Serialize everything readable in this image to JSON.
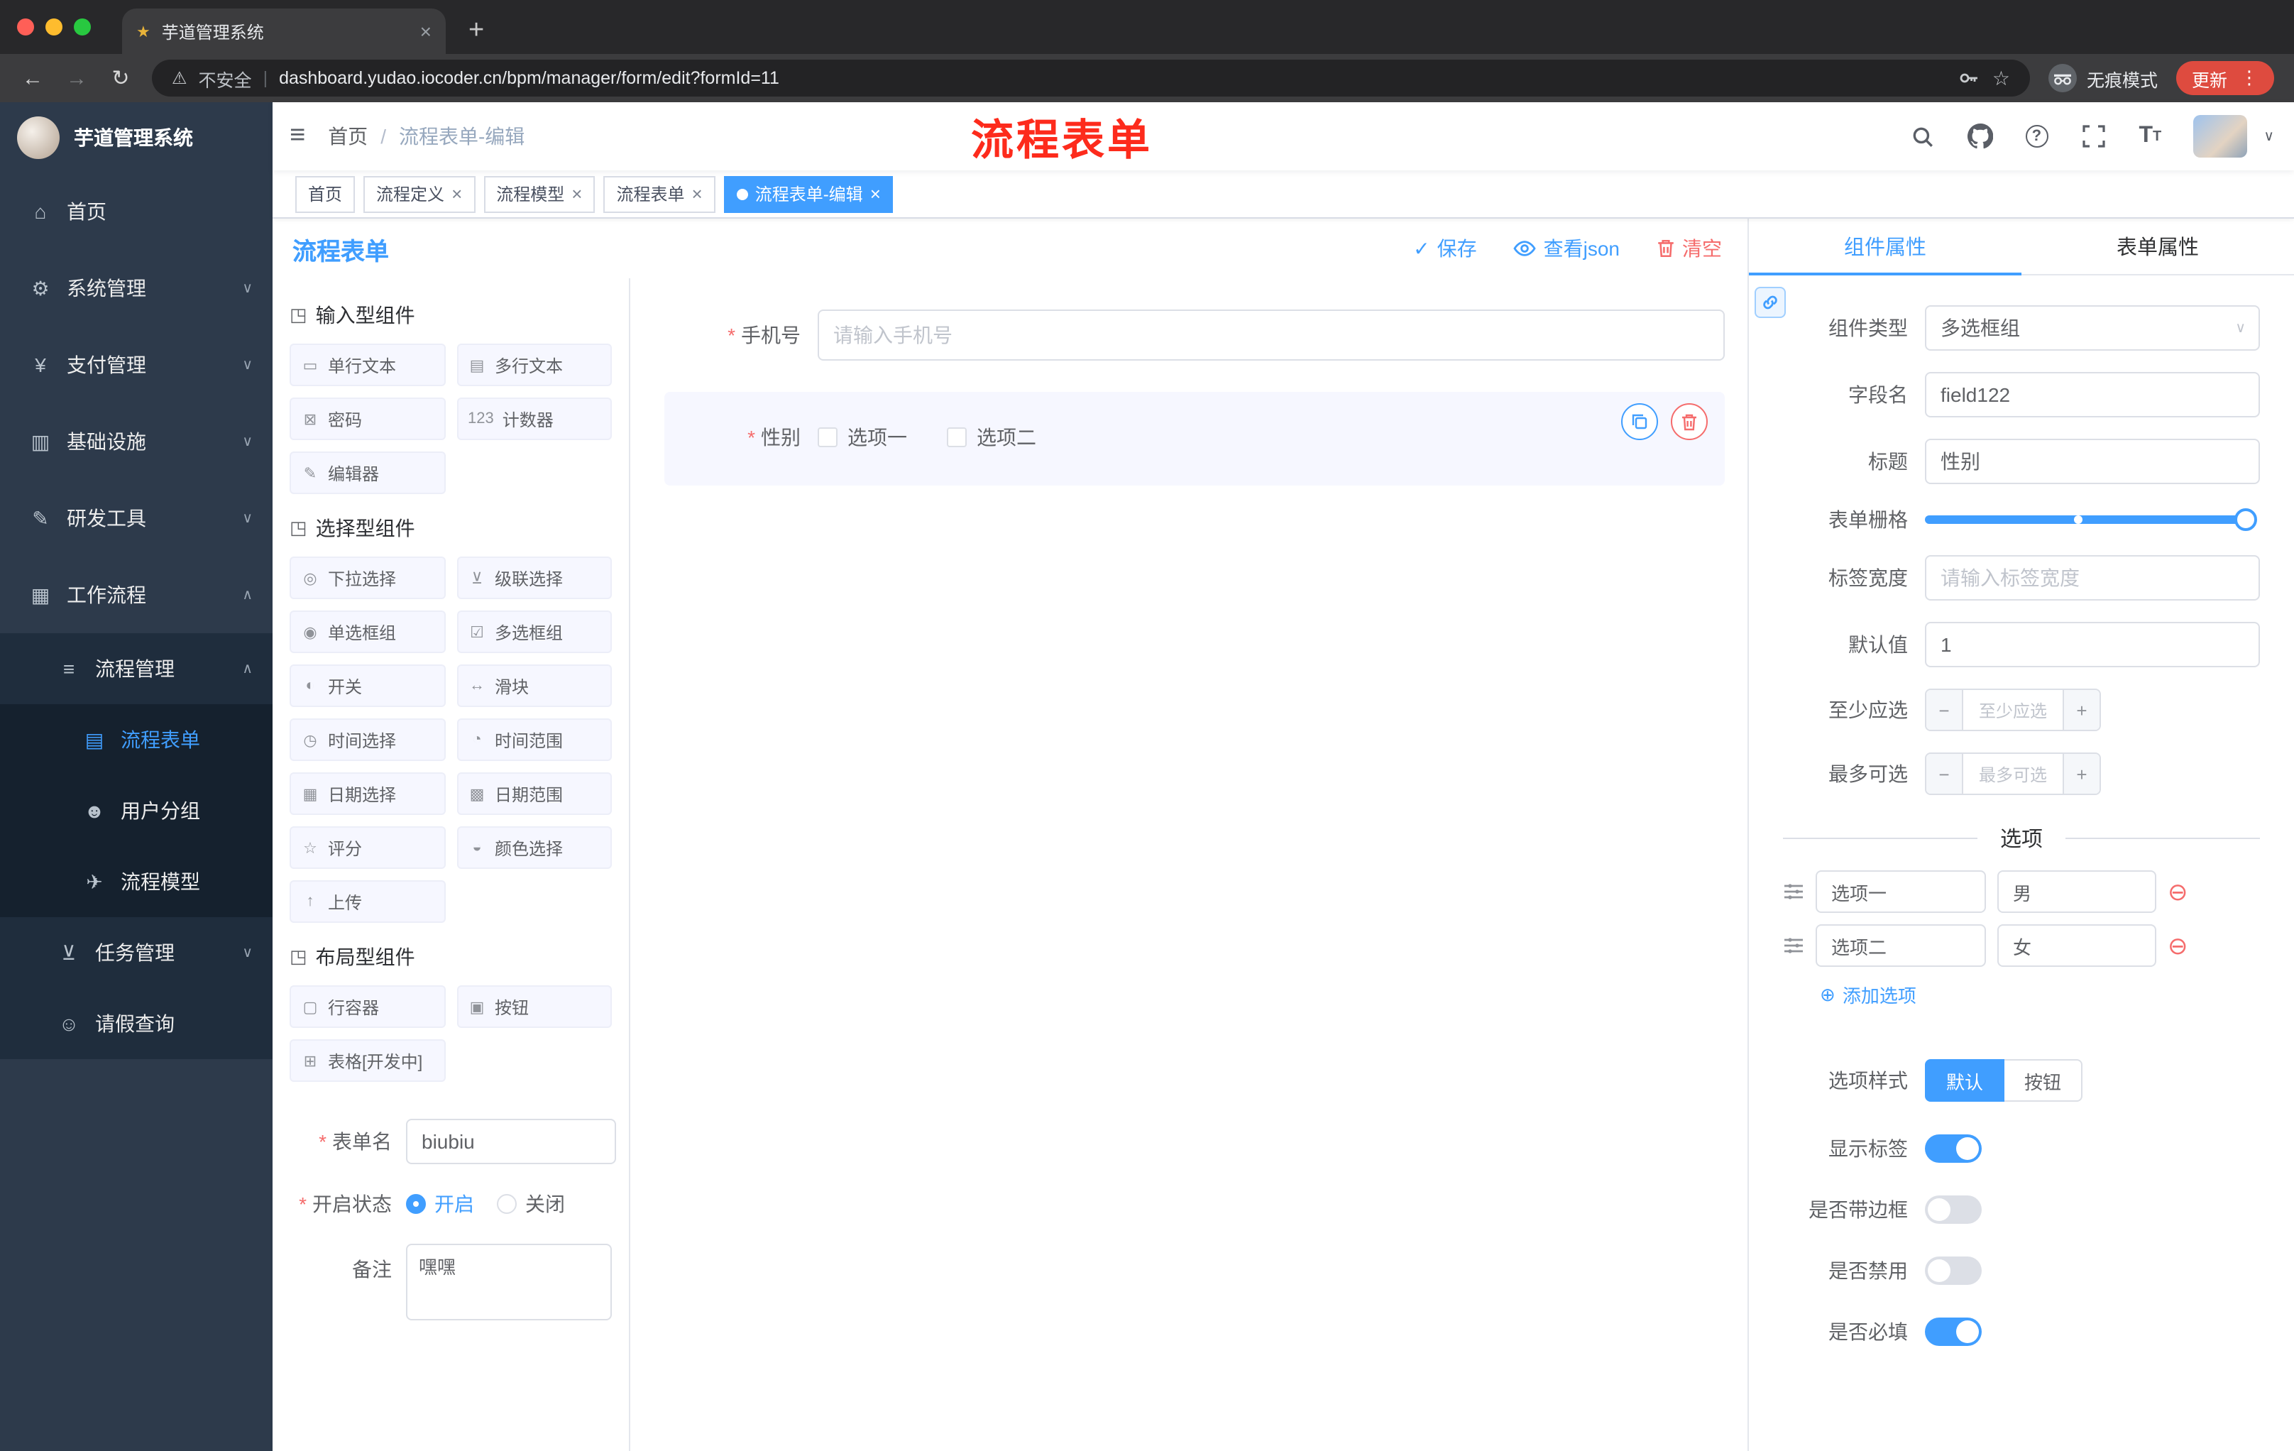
{
  "colors": {
    "primary": "#409eff",
    "danger": "#f56c6c",
    "annotation_red": "#fd2b1c",
    "sidebar_bg": "#2d3a4b"
  },
  "icons": {
    "hamburger": "≡",
    "back": "←",
    "forward": "→",
    "reload": "↻",
    "warning": "⚠",
    "pipe": "|",
    "star": "☆",
    "menu_dots": "⋮",
    "close": "×",
    "new_tab": "+",
    "favicon": "★",
    "caret_down": "∨",
    "check": "✓",
    "question": "?",
    "font_size": "T",
    "plus_circle": "⊕",
    "minus_circle": "⊖",
    "minus": "−",
    "plus": "+"
  },
  "browser": {
    "tab": {
      "title": "芋道管理系统"
    },
    "toolbar": {
      "security_label": "不安全",
      "url": "dashboard.yudao.iocoder.cn/bpm/manager/form/edit?formId=11",
      "incognito_label": "无痕模式",
      "update_label": "更新"
    }
  },
  "sidebar": {
    "brand": "芋道管理系统",
    "menu": [
      {
        "icon": "⌂",
        "label": "首页",
        "level": 1,
        "chevron": ""
      },
      {
        "icon": "⚙",
        "label": "系统管理",
        "level": 1,
        "chevron": "∨"
      },
      {
        "icon": "¥",
        "label": "支付管理",
        "level": 1,
        "chevron": "∨"
      },
      {
        "icon": "▥",
        "label": "基础设施",
        "level": 1,
        "chevron": "∨"
      },
      {
        "icon": "✎",
        "label": "研发工具",
        "level": 1,
        "chevron": "∨"
      },
      {
        "icon": "▦",
        "label": "工作流程",
        "level": 1,
        "chevron": "∧",
        "expanded": true
      },
      {
        "icon": "≡",
        "label": "流程管理",
        "level": 2,
        "chevron": "∧",
        "expanded": true
      },
      {
        "icon": "▤",
        "label": "流程表单",
        "level": 3,
        "chevron": "",
        "active": true
      },
      {
        "icon": "☻",
        "label": "用户分组",
        "level": 3,
        "chevron": ""
      },
      {
        "icon": "✈",
        "label": "流程模型",
        "level": 3,
        "chevron": ""
      },
      {
        "icon": "⊻",
        "label": "任务管理",
        "level": 2,
        "chevron": "∨"
      },
      {
        "icon": "☺",
        "label": "请假查询",
        "level": 2,
        "chevron": ""
      }
    ]
  },
  "header": {
    "breadcrumb": {
      "root": "首页",
      "separator": "/",
      "current": "流程表单-编辑"
    },
    "annotation": "流程表单"
  },
  "tags": [
    {
      "label": "首页",
      "closable": false,
      "active": false
    },
    {
      "label": "流程定义",
      "closable": true,
      "active": false
    },
    {
      "label": "流程模型",
      "closable": true,
      "active": false
    },
    {
      "label": "流程表单",
      "closable": true,
      "active": false
    },
    {
      "label": "流程表单-编辑",
      "closable": true,
      "active": true
    }
  ],
  "designer": {
    "title": "流程表单",
    "actions": {
      "save": "保存",
      "view_json": "查看json",
      "clear": "清空"
    },
    "palette": {
      "groups": [
        {
          "icon": "◳",
          "title": "输入型组件",
          "items": [
            {
              "icon": "▭",
              "label": "单行文本"
            },
            {
              "icon": "▤",
              "label": "多行文本"
            },
            {
              "icon": "⊠",
              "label": "密码"
            },
            {
              "icon": "123",
              "label": "计数器"
            },
            {
              "icon": "✎",
              "label": "编辑器"
            }
          ]
        },
        {
          "icon": "◳",
          "title": "选择型组件",
          "items": [
            {
              "icon": "◎",
              "label": "下拉选择"
            },
            {
              "icon": "⊻",
              "label": "级联选择"
            },
            {
              "icon": "◉",
              "label": "单选框组"
            },
            {
              "icon": "☑",
              "label": "多选框组"
            },
            {
              "icon": "◐",
              "label": "开关"
            },
            {
              "icon": "↔",
              "label": "滑块"
            },
            {
              "icon": "◷",
              "label": "时间选择"
            },
            {
              "icon": "◔",
              "label": "时间范围"
            },
            {
              "icon": "▦",
              "label": "日期选择"
            },
            {
              "icon": "▩",
              "label": "日期范围"
            },
            {
              "icon": "☆",
              "label": "评分"
            },
            {
              "icon": "◒",
              "label": "颜色选择"
            },
            {
              "icon": "↑",
              "label": "上传"
            }
          ]
        },
        {
          "icon": "◳",
          "title": "布局型组件",
          "items": [
            {
              "icon": "▢",
              "label": "行容器"
            },
            {
              "icon": "▣",
              "label": "按钮"
            },
            {
              "icon": "⊞",
              "label": "表格[开发中]"
            }
          ]
        }
      ]
    },
    "meta": {
      "name_label": "表单名",
      "name_value": "biubiu",
      "status_label": "开启状态",
      "status_on": "开启",
      "status_off": "关闭",
      "status_checked": "开启",
      "remark_label": "备注",
      "remark_value": "嘿嘿"
    },
    "canvas": {
      "phone": {
        "label": "手机号",
        "required": true,
        "placeholder": "请输入手机号"
      },
      "gender": {
        "label": "性别",
        "required": true,
        "selected": true,
        "options": [
          "选项一",
          "选项二"
        ]
      }
    }
  },
  "props": {
    "tab_component": "组件属性",
    "tab_form": "表单属性",
    "rows": {
      "component_type": {
        "label": "组件类型",
        "value": "多选框组"
      },
      "field_name": {
        "label": "字段名",
        "value": "field122"
      },
      "title": {
        "label": "标题",
        "value": "性别"
      },
      "grid": {
        "label": "表单栅格",
        "value_hint": "slider at max, stop at 48%"
      },
      "label_width": {
        "label": "标签宽度",
        "placeholder": "请输入标签宽度"
      },
      "default": {
        "label": "默认值",
        "value": "1"
      },
      "min": {
        "label": "至少应选",
        "placeholder": "至少应选"
      },
      "max": {
        "label": "最多可选",
        "placeholder": "最多可选"
      }
    },
    "options": {
      "title": "选项",
      "rows": [
        {
          "name": "选项一",
          "value": "男"
        },
        {
          "name": "选项二",
          "value": "女"
        }
      ],
      "add_label": "添加选项"
    },
    "style": {
      "option_style_label": "选项样式",
      "btn_default": "默认",
      "btn_button": "按钮",
      "selected": "默认",
      "toggles": [
        {
          "label": "显示标签",
          "on": true
        },
        {
          "label": "是否带边框",
          "on": false
        },
        {
          "label": "是否禁用",
          "on": false
        },
        {
          "label": "是否必填",
          "on": true
        }
      ]
    }
  }
}
